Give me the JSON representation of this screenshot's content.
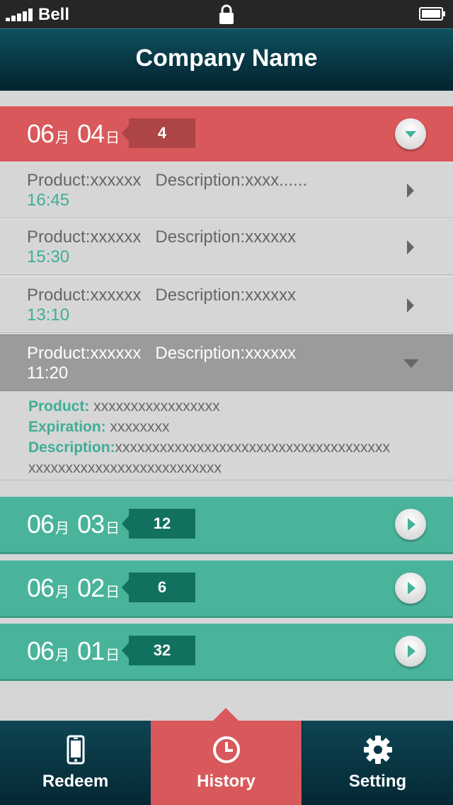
{
  "status_bar": {
    "carrier": "Bell",
    "signal_bars": 5,
    "battery": "full"
  },
  "header": {
    "title": "Company Name"
  },
  "groups": [
    {
      "month": "06",
      "month_suffix": "月",
      "day": "04",
      "day_suffix": "日",
      "count": "4",
      "state": "expanded",
      "color": "#d9585b"
    },
    {
      "month": "06",
      "month_suffix": "月",
      "day": "03",
      "day_suffix": "日",
      "count": "12",
      "state": "collapsed",
      "color": "#49b49b"
    },
    {
      "month": "06",
      "month_suffix": "月",
      "day": "02",
      "day_suffix": "日",
      "count": "6",
      "state": "collapsed",
      "color": "#49b49b"
    },
    {
      "month": "06",
      "month_suffix": "月",
      "day": "01",
      "day_suffix": "日",
      "count": "32",
      "state": "collapsed",
      "color": "#49b49b"
    }
  ],
  "items": [
    {
      "product": "Product:xxxxxx",
      "description": "Description:xxxx......",
      "time": "16:45"
    },
    {
      "product": "Product:xxxxxx",
      "description": "Description:xxxxxx",
      "time": "15:30"
    },
    {
      "product": "Product:xxxxxx",
      "description": "Description:xxxxxx",
      "time": "13:10"
    },
    {
      "product": "Product:xxxxxx",
      "description": "Description:xxxxxx",
      "time": "11:20",
      "state": "expanded"
    }
  ],
  "detail": {
    "product_label": "Product:",
    "product_value": "xxxxxxxxxxxxxxxxx",
    "expiration_label": "Expiration:",
    "expiration_value": "xxxxxxxx",
    "description_label": "Description:",
    "description_value": "xxxxxxxxxxxxxxxxxxxxxxxxxxxxxxxxxxxxx",
    "description_value_2": "xxxxxxxxxxxxxxxxxxxxxxxxxx"
  },
  "tabs": [
    {
      "label": "Redeem",
      "icon": "phone-icon"
    },
    {
      "label": "History",
      "icon": "clock-icon",
      "active": true
    },
    {
      "label": "Setting",
      "icon": "gear-icon"
    }
  ],
  "colors": {
    "accent_red": "#d9585b",
    "accent_teal": "#49b49b",
    "header_dark": "#083643",
    "time_green": "#3fae95"
  }
}
